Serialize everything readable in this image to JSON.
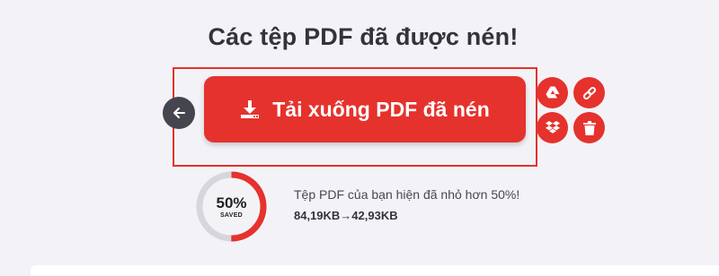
{
  "page": {
    "title": "Các tệp PDF đã được nén!"
  },
  "actions": {
    "download_label": "Tải xuống PDF đã nén",
    "back_icon": "arrow-left-icon",
    "download_icon": "download-icon",
    "side_buttons": [
      "google-drive-icon",
      "link-icon",
      "dropbox-icon",
      "trash-icon"
    ]
  },
  "result": {
    "percent_label": "50%",
    "saved_label": "SAVED",
    "saved_fraction": 0.5,
    "message": "Tệp PDF của bạn hiện đã nhỏ hơn 50%!",
    "sizes": "84,19KB→42,93KB"
  },
  "colors": {
    "accent": "#e5322d",
    "ring_track": "#d6d6db",
    "highlight_border": "#e5312d"
  }
}
